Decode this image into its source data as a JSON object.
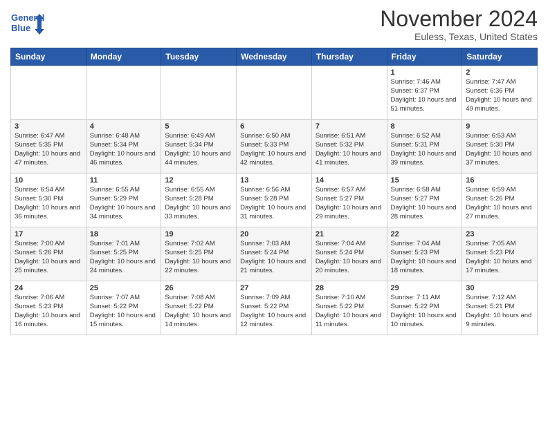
{
  "header": {
    "logo_line1": "General",
    "logo_line2": "Blue",
    "month": "November 2024",
    "location": "Euless, Texas, United States"
  },
  "days_of_week": [
    "Sunday",
    "Monday",
    "Tuesday",
    "Wednesday",
    "Thursday",
    "Friday",
    "Saturday"
  ],
  "weeks": [
    [
      {
        "day": "",
        "info": ""
      },
      {
        "day": "",
        "info": ""
      },
      {
        "day": "",
        "info": ""
      },
      {
        "day": "",
        "info": ""
      },
      {
        "day": "",
        "info": ""
      },
      {
        "day": "1",
        "info": "Sunrise: 7:46 AM\nSunset: 6:37 PM\nDaylight: 10 hours and 51 minutes."
      },
      {
        "day": "2",
        "info": "Sunrise: 7:47 AM\nSunset: 6:36 PM\nDaylight: 10 hours and 49 minutes."
      }
    ],
    [
      {
        "day": "3",
        "info": "Sunrise: 6:47 AM\nSunset: 5:35 PM\nDaylight: 10 hours and 47 minutes."
      },
      {
        "day": "4",
        "info": "Sunrise: 6:48 AM\nSunset: 5:34 PM\nDaylight: 10 hours and 46 minutes."
      },
      {
        "day": "5",
        "info": "Sunrise: 6:49 AM\nSunset: 5:34 PM\nDaylight: 10 hours and 44 minutes."
      },
      {
        "day": "6",
        "info": "Sunrise: 6:50 AM\nSunset: 5:33 PM\nDaylight: 10 hours and 42 minutes."
      },
      {
        "day": "7",
        "info": "Sunrise: 6:51 AM\nSunset: 5:32 PM\nDaylight: 10 hours and 41 minutes."
      },
      {
        "day": "8",
        "info": "Sunrise: 6:52 AM\nSunset: 5:31 PM\nDaylight: 10 hours and 39 minutes."
      },
      {
        "day": "9",
        "info": "Sunrise: 6:53 AM\nSunset: 5:30 PM\nDaylight: 10 hours and 37 minutes."
      }
    ],
    [
      {
        "day": "10",
        "info": "Sunrise: 6:54 AM\nSunset: 5:30 PM\nDaylight: 10 hours and 36 minutes."
      },
      {
        "day": "11",
        "info": "Sunrise: 6:55 AM\nSunset: 5:29 PM\nDaylight: 10 hours and 34 minutes."
      },
      {
        "day": "12",
        "info": "Sunrise: 6:55 AM\nSunset: 5:28 PM\nDaylight: 10 hours and 33 minutes."
      },
      {
        "day": "13",
        "info": "Sunrise: 6:56 AM\nSunset: 5:28 PM\nDaylight: 10 hours and 31 minutes."
      },
      {
        "day": "14",
        "info": "Sunrise: 6:57 AM\nSunset: 5:27 PM\nDaylight: 10 hours and 29 minutes."
      },
      {
        "day": "15",
        "info": "Sunrise: 6:58 AM\nSunset: 5:27 PM\nDaylight: 10 hours and 28 minutes."
      },
      {
        "day": "16",
        "info": "Sunrise: 6:59 AM\nSunset: 5:26 PM\nDaylight: 10 hours and 27 minutes."
      }
    ],
    [
      {
        "day": "17",
        "info": "Sunrise: 7:00 AM\nSunset: 5:26 PM\nDaylight: 10 hours and 25 minutes."
      },
      {
        "day": "18",
        "info": "Sunrise: 7:01 AM\nSunset: 5:25 PM\nDaylight: 10 hours and 24 minutes."
      },
      {
        "day": "19",
        "info": "Sunrise: 7:02 AM\nSunset: 5:25 PM\nDaylight: 10 hours and 22 minutes."
      },
      {
        "day": "20",
        "info": "Sunrise: 7:03 AM\nSunset: 5:24 PM\nDaylight: 10 hours and 21 minutes."
      },
      {
        "day": "21",
        "info": "Sunrise: 7:04 AM\nSunset: 5:24 PM\nDaylight: 10 hours and 20 minutes."
      },
      {
        "day": "22",
        "info": "Sunrise: 7:04 AM\nSunset: 5:23 PM\nDaylight: 10 hours and 18 minutes."
      },
      {
        "day": "23",
        "info": "Sunrise: 7:05 AM\nSunset: 5:23 PM\nDaylight: 10 hours and 17 minutes."
      }
    ],
    [
      {
        "day": "24",
        "info": "Sunrise: 7:06 AM\nSunset: 5:23 PM\nDaylight: 10 hours and 16 minutes."
      },
      {
        "day": "25",
        "info": "Sunrise: 7:07 AM\nSunset: 5:22 PM\nDaylight: 10 hours and 15 minutes."
      },
      {
        "day": "26",
        "info": "Sunrise: 7:08 AM\nSunset: 5:22 PM\nDaylight: 10 hours and 14 minutes."
      },
      {
        "day": "27",
        "info": "Sunrise: 7:09 AM\nSunset: 5:22 PM\nDaylight: 10 hours and 12 minutes."
      },
      {
        "day": "28",
        "info": "Sunrise: 7:10 AM\nSunset: 5:22 PM\nDaylight: 10 hours and 11 minutes."
      },
      {
        "day": "29",
        "info": "Sunrise: 7:11 AM\nSunset: 5:22 PM\nDaylight: 10 hours and 10 minutes."
      },
      {
        "day": "30",
        "info": "Sunrise: 7:12 AM\nSunset: 5:21 PM\nDaylight: 10 hours and 9 minutes."
      }
    ]
  ]
}
